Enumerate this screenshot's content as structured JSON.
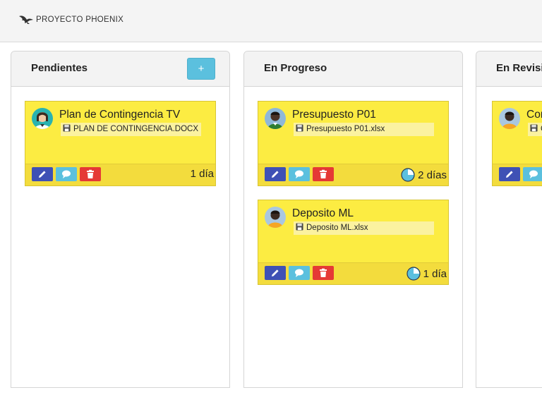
{
  "app": {
    "name": "PROYECTO PHOENIX",
    "logo_icon": "phoenix-logo-icon"
  },
  "columns": [
    {
      "title": "Pendientes",
      "add_label": "+",
      "cards": [
        {
          "title": "Plan de Contingencia TV",
          "attachment": "PLAN DE CONTINGENCIA.DOCX",
          "due": "1 día",
          "clock": false,
          "avatar": "woman-teal"
        }
      ]
    },
    {
      "title": "En Progreso",
      "cards": [
        {
          "title": "Presupuesto P01",
          "attachment": "Presupuesto P01.xlsx",
          "due": "2 días",
          "clock": true,
          "avatar": "man-green"
        },
        {
          "title": "Deposito ML",
          "attachment": "Deposito ML.xlsx",
          "due": "1 día",
          "clock": true,
          "avatar": "man-orange"
        }
      ]
    },
    {
      "title": "En Revisi",
      "cards": [
        {
          "title": "Con",
          "attachment": "C",
          "due": "",
          "clock": false,
          "avatar": "man-orange"
        }
      ]
    }
  ],
  "colors": {
    "card": "#fcec42",
    "card_footer": "#f3dc3d",
    "edit": "#3f51b5",
    "comment": "#5bc0de",
    "delete": "#e53935",
    "add": "#5bc0de"
  },
  "icons": {
    "edit": "pencil-icon",
    "comment": "comment-icon",
    "delete": "trash-icon",
    "attachment": "floppy-disk-icon",
    "due": "clock-icon"
  }
}
